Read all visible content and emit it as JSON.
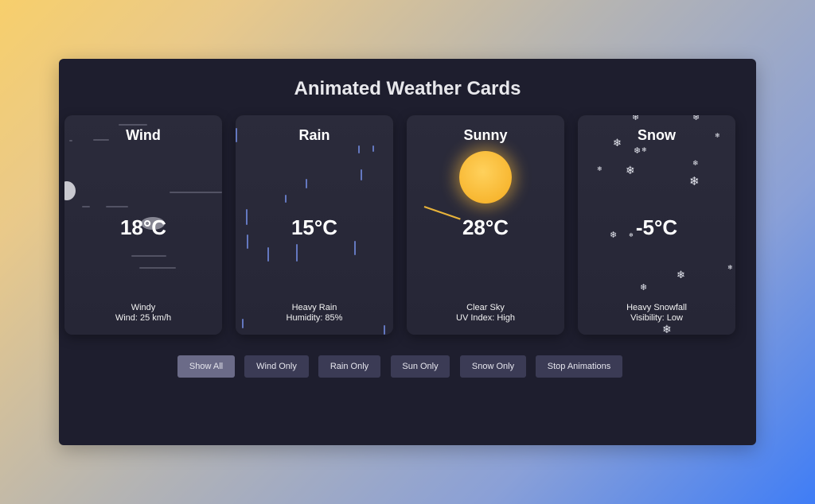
{
  "page": {
    "title": "Animated Weather Cards"
  },
  "cards": [
    {
      "name": "Wind",
      "temp": "18°C",
      "desc": "Windy",
      "detail": "Wind: 25 km/h"
    },
    {
      "name": "Rain",
      "temp": "15°C",
      "desc": "Heavy Rain",
      "detail": "Humidity: 85%"
    },
    {
      "name": "Sunny",
      "temp": "28°C",
      "desc": "Clear Sky",
      "detail": "UV Index: High"
    },
    {
      "name": "Snow",
      "temp": "-5°C",
      "desc": "Heavy Snowfall",
      "detail": "Visibility: Low"
    }
  ],
  "controls": {
    "show_all": "Show All",
    "wind_only": "Wind Only",
    "rain_only": "Rain Only",
    "sun_only": "Sun Only",
    "snow_only": "Snow Only",
    "stop_animations": "Stop Animations",
    "active": "show_all"
  },
  "colors": {
    "panel": "#1e1e2e",
    "card": "#2b2b3b",
    "button": "#3b3b55",
    "button_active": "#6b6b88",
    "rain_drop": "#6f86d8",
    "sun": "#f7b52e"
  }
}
